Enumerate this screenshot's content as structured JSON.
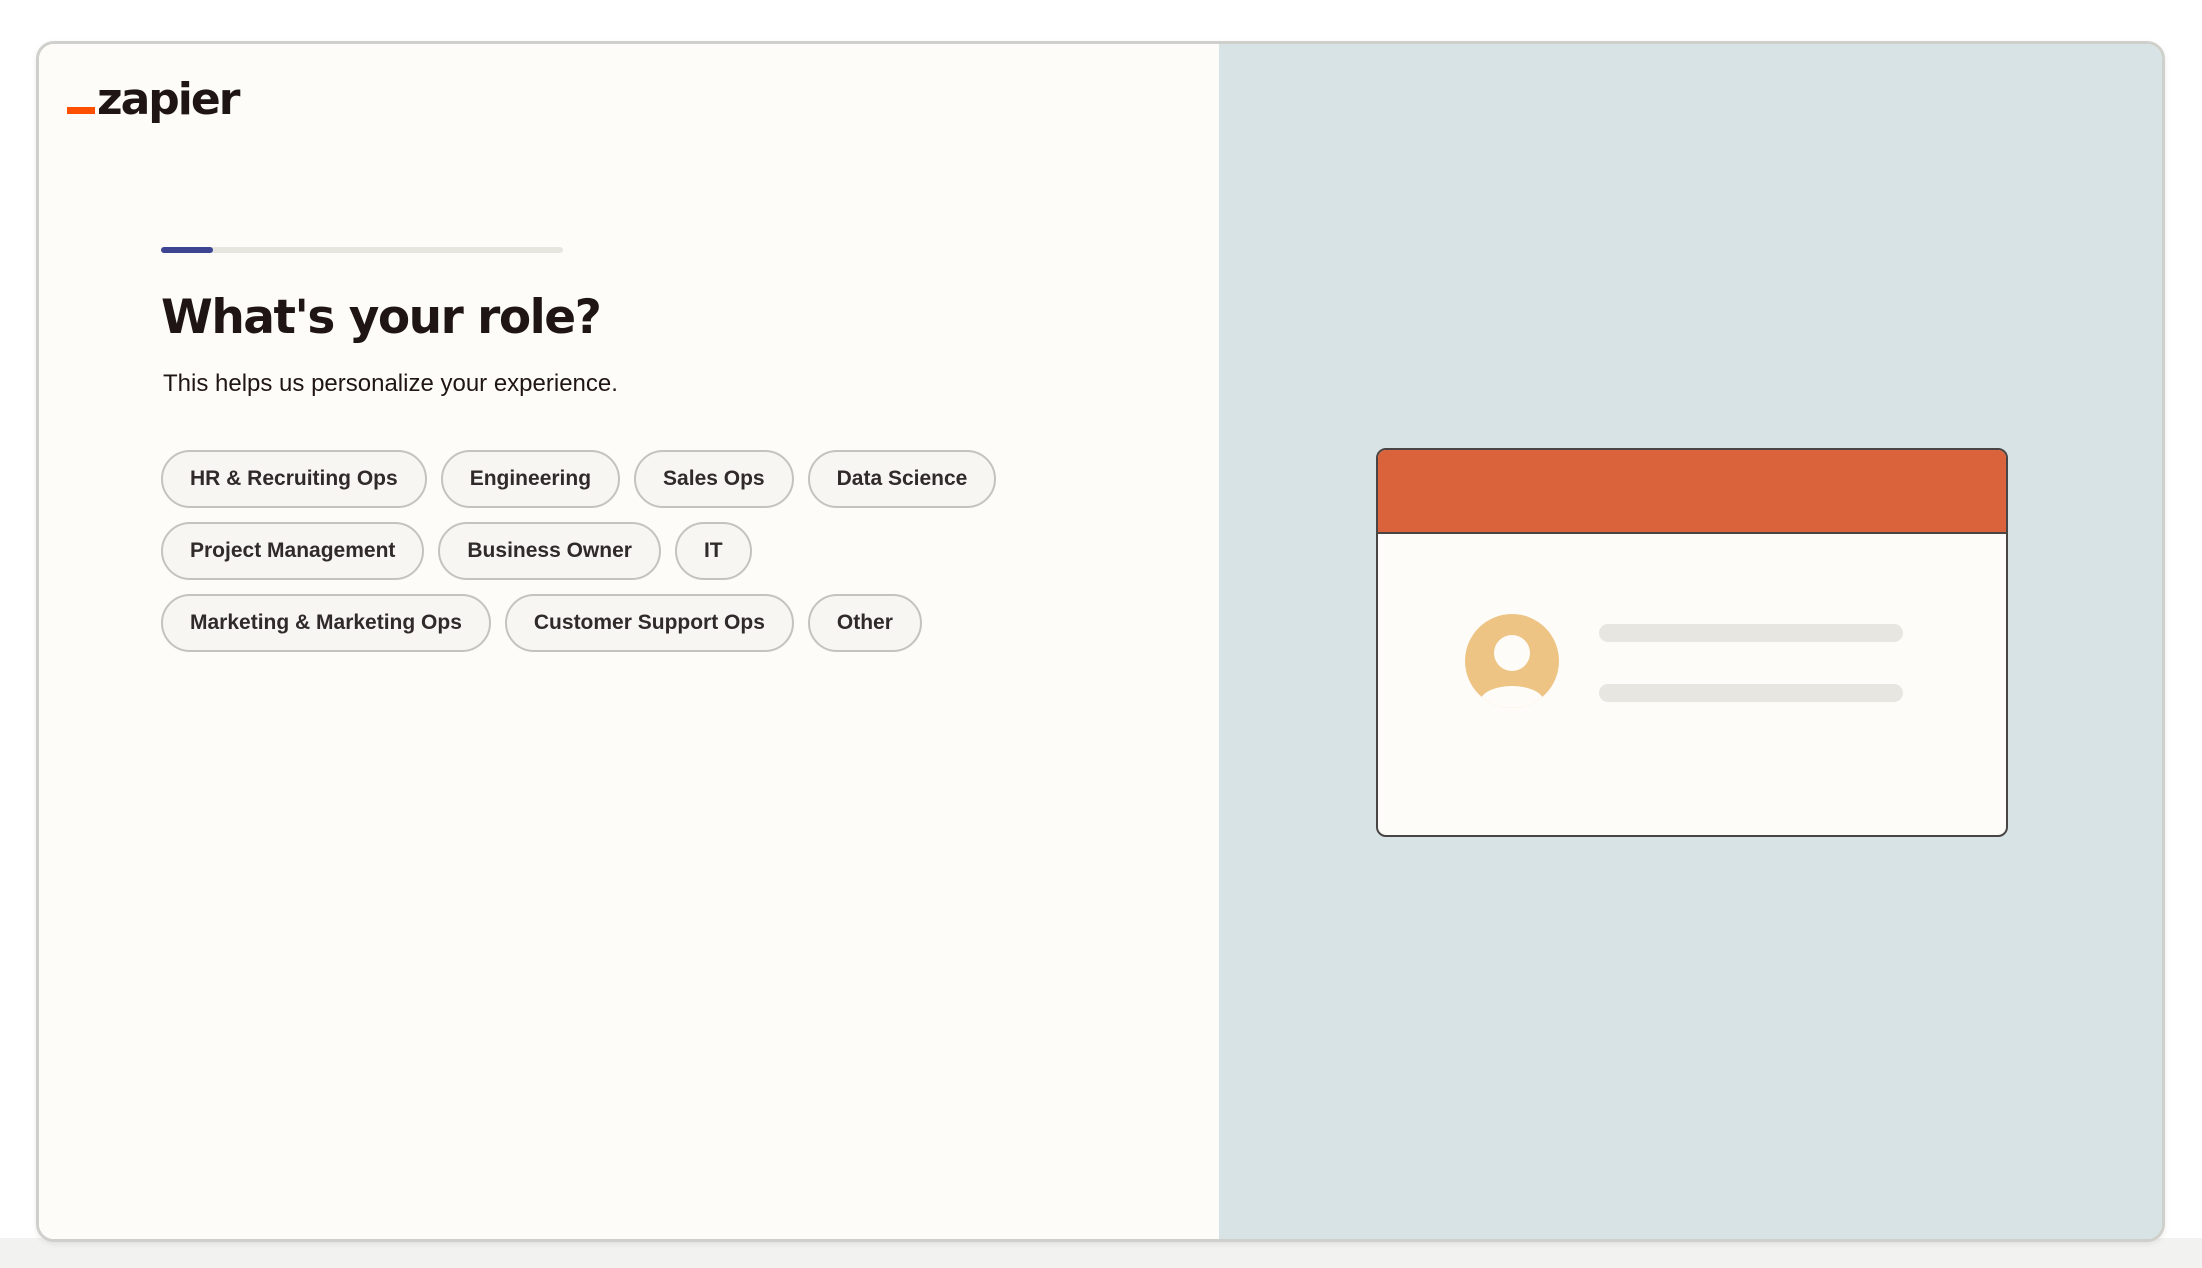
{
  "brand": {
    "name": "zapier",
    "accent_color": "#ff4f00"
  },
  "onboarding": {
    "progress_fraction": 0.13,
    "title": "What's your role?",
    "subtitle": "This helps us personalize your experience.",
    "roles": [
      [
        "HR & Recruiting Ops",
        "Engineering",
        "Sales Ops",
        "Data Science"
      ],
      [
        "Project Management",
        "Business Owner",
        "IT"
      ],
      [
        "Marketing & Marketing Ops",
        "Customer Support Ops",
        "Other"
      ]
    ]
  },
  "illustration": {
    "header_color": "#db633c",
    "avatar_color": "#edc483",
    "panel_color": "#d7e3e4"
  }
}
